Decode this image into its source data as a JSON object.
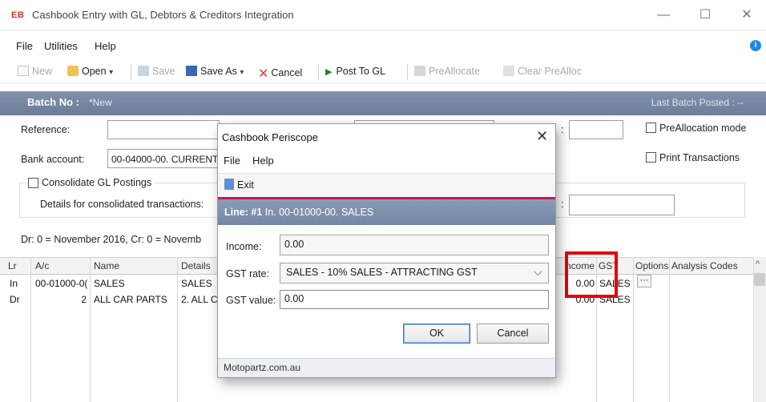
{
  "window": {
    "logo": "EB",
    "title": "Cashbook Entry with GL, Debtors & Creditors Integration",
    "minimize": "—",
    "maximize": "☐",
    "close": "✕"
  },
  "menu": {
    "file": "File",
    "utilities": "Utilities",
    "help": "Help",
    "info": "i"
  },
  "toolbar": {
    "new": "New",
    "open": "Open",
    "save": "Save",
    "save_as": "Save As",
    "cancel": "Cancel",
    "post_to_gl": "Post To GL",
    "preallocate": "PreAllocate",
    "clear_prealloc": "Clear PreAlloc",
    "dropdown": "▾"
  },
  "batch": {
    "label": "Batch No :",
    "value": "*New",
    "last_posted": "Last Batch Posted : --"
  },
  "form": {
    "reference_label": "Reference:",
    "reference_value": "",
    "bank_label": "Bank account:",
    "bank_value": "00-04000-00. CURRENT",
    "consolidate_label": "Consolidate GL Postings",
    "details_label": "Details for consolidated transactions:",
    "period_text": "Dr: 0 = November 2016,  Cr: 0 = Novemb",
    "prealloc_label": "PreAllocation mode",
    "print_label": "Print Transactions",
    "colon_glyph": ":"
  },
  "grid": {
    "headers": [
      "Lr",
      "A/c",
      "Name",
      "Details",
      "Income",
      "GST",
      "Options",
      "Analysis Codes"
    ],
    "rows": [
      {
        "lr": "In",
        "ac": "00-01000-0(",
        "name": "SALES",
        "details": "SALES",
        "income": "0.00",
        "gst": "SALES",
        "options": "···"
      },
      {
        "lr": "Dr",
        "ac": "2",
        "name": "ALL CAR PARTS",
        "details": "2. ALL C",
        "income": "0.00",
        "gst": "SALES",
        "options": ""
      }
    ],
    "scroll_up": "^"
  },
  "dialog": {
    "title": "Cashbook Periscope",
    "close": "✕",
    "menu_file": "File",
    "menu_help": "Help",
    "exit": "Exit",
    "line_label": "Line: #1",
    "line_text": "In. 00-01000-00. SALES",
    "income_label": "Income:",
    "income_value": "0.00",
    "gst_rate_label": "GST rate:",
    "gst_rate_value": "SALES - 10% SALES - ATTRACTING GST",
    "gst_value_label": "GST value:",
    "gst_value": "0.00",
    "ok": "OK",
    "cancel": "Cancel",
    "status": "Motopartz.com.au",
    "dropdown_glyph": "⌵"
  },
  "colors": {
    "batch_bar": "#7a8ba6",
    "accent": "#c2185b",
    "highlight_box": "#e60000",
    "ok_border": "#2f73d3"
  }
}
